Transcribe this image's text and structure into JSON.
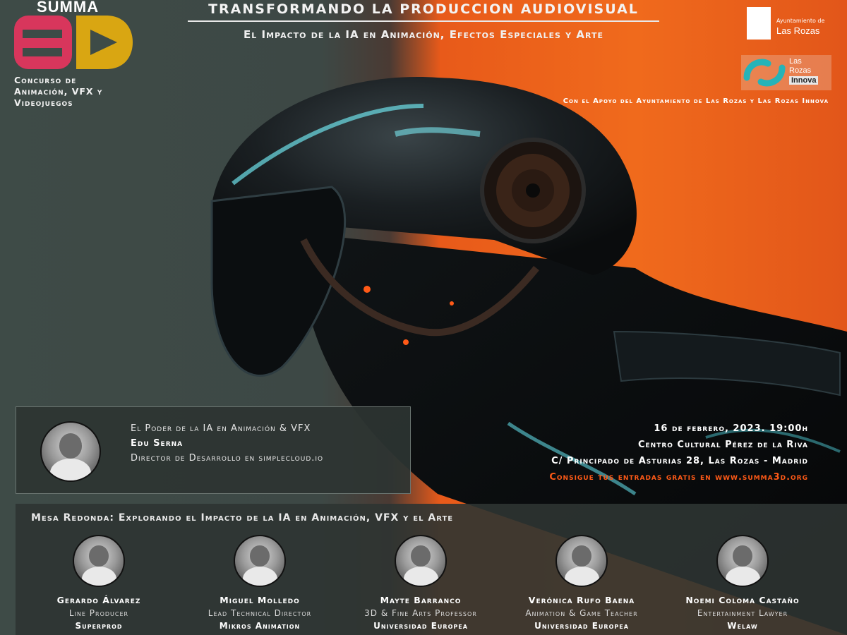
{
  "logo": {
    "word": "SUMMA",
    "mark": "3D",
    "subtitle": [
      "Concurso de",
      "Animación, VFX y",
      "Videojuegos"
    ]
  },
  "header": {
    "title": "TRANSFORMANDO LA PRODUCCION AUDIOVISUAL",
    "subtitle": "El Impacto de la IA en Animación, Efectos Especiales y Arte"
  },
  "sponsors": {
    "ayuntamiento_small": "Ayuntamiento de",
    "ayuntamiento_name": "Las Rozas",
    "innova_line1": "Las",
    "innova_line2": "Rozas",
    "innova_line3": "Innova",
    "support": "Con el Apoyo del Ayuntamiento de Las Rozas y Las Rozas Innova"
  },
  "keynote": {
    "topic": "El Poder de la IA en Animación & VFX",
    "name": "Edu Serna",
    "role": "Director de Desarrollo en simplecloud.io"
  },
  "event": {
    "date": "16 de febrero, 2023. 19:00h",
    "venue": "Centro Cultural Pérez de la Riva",
    "address": "C/ Principado de Asturias 28, Las Rozas - Madrid",
    "cta": "Consigue tus entradas gratis en www.summa3d.org"
  },
  "round_table": {
    "title": "Mesa Redonda: Explorando el Impacto de la IA en Animación, VFX y el Arte",
    "panelists": [
      {
        "name": "Gerardo Álvarez",
        "role": "Line Producer",
        "org": "Superprod"
      },
      {
        "name": "Miguel Molledo",
        "role": "Lead Technical Director",
        "org": "Mikros Animation"
      },
      {
        "name": "Mayte Barranco",
        "role": "3D & Fine Arts Professor",
        "org": "Universidad Europea"
      },
      {
        "name": "Verónica Rufo Baena",
        "role": "Animation & Game Teacher",
        "org": "Universidad Europea"
      },
      {
        "name": "Noemi Coloma Castaño",
        "role": "Entertainment Lawyer",
        "org": "Welaw"
      }
    ]
  },
  "colors": {
    "accent_orange": "#ff5a17",
    "logo_red": "#d8365c",
    "logo_gold": "#d9a612"
  }
}
